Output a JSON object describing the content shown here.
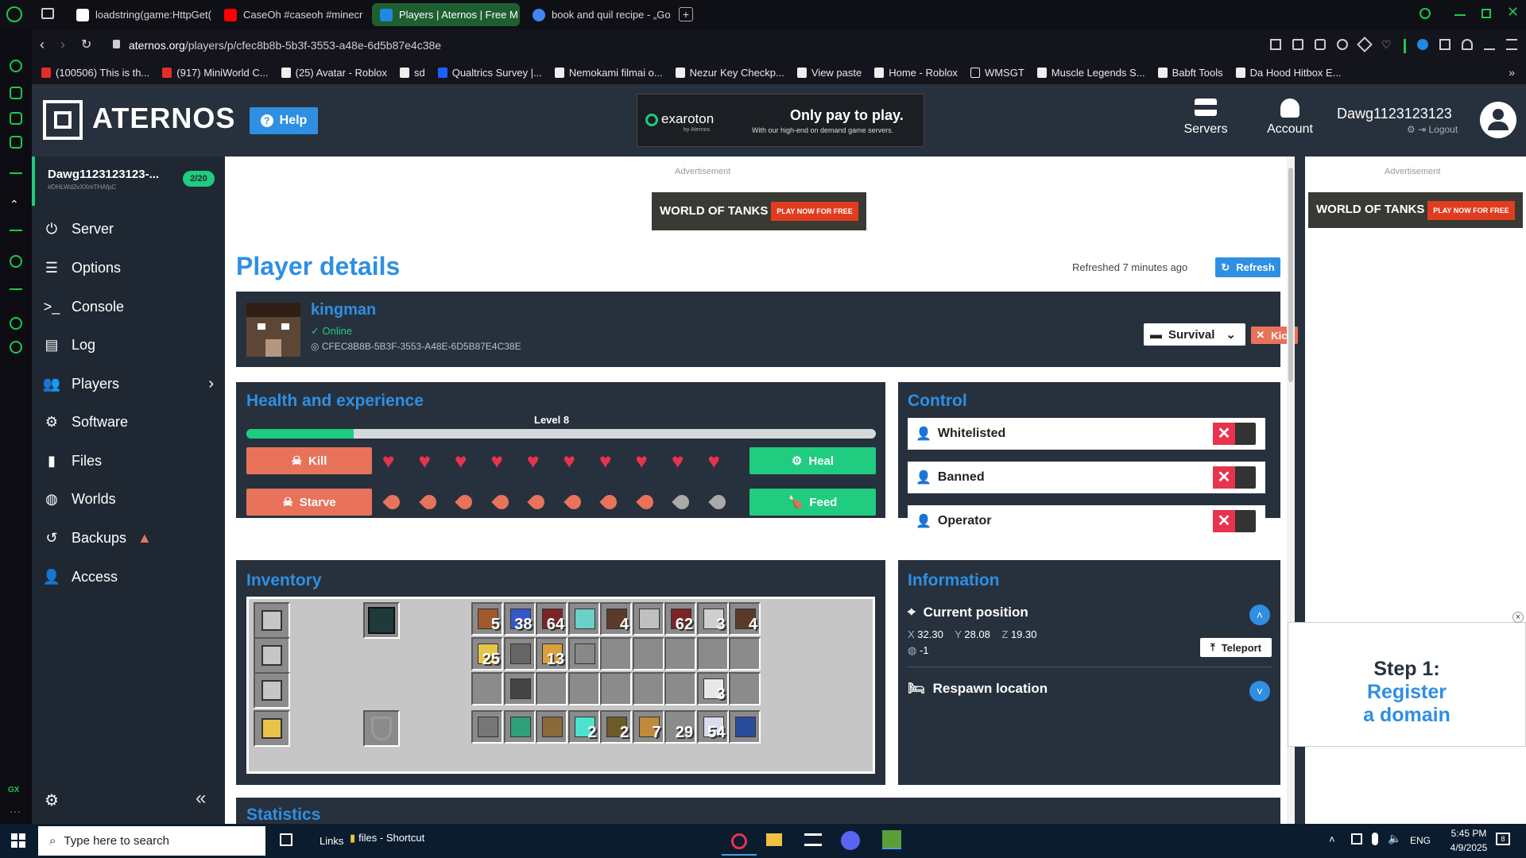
{
  "browser": {
    "tabs": [
      {
        "label": "loadstring(game:HttpGet(",
        "color": "#ffffff"
      },
      {
        "label": "CaseOh #caseoh #minecr",
        "color": "#ff0000"
      },
      {
        "label": "Players | Aternos | Free M",
        "color": "#1e88e5"
      },
      {
        "label": "book and quil recipe - „Go",
        "color": "#4285f4"
      }
    ],
    "new_tab": "+",
    "url_domain": "aternos.org",
    "url_path": "/players/p/cfec8b8b-5b3f-3553-a48e-6d5b87e4c38e",
    "bookmarks": [
      "(100506) This is th...",
      "(917) MiniWorld C...",
      "(25) Avatar - Roblox",
      "sd",
      "Qualtrics Survey |...",
      "Nemokami filmai o...",
      "Nezur Key Checkp...",
      "View paste",
      "Home - Roblox",
      "WMSGT",
      "Muscle Legends S...",
      "Babft Tools",
      "Da Hood Hitbox E..."
    ],
    "gx_label": "GX"
  },
  "header": {
    "logo": "ATERNOS",
    "help": "Help",
    "ad_brand": "exaroton",
    "ad_brand_sub": "by Aternos",
    "ad_headline": "Only pay to play.",
    "ad_sub": "With our high-end on demand game servers.",
    "servers": "Servers",
    "account": "Account",
    "username": "Dawg1123123123",
    "logout": "Logout"
  },
  "sidebar": {
    "server_name": "Dawg1123123123-...",
    "server_id": "#DHLWd2vXXmTHAfpC",
    "players_badge": "2/20",
    "items": [
      "Server",
      "Options",
      "Console",
      "Log",
      "Players",
      "Software",
      "Files",
      "Worlds",
      "Backups",
      "Access"
    ]
  },
  "main": {
    "ad_label": "Advertisement",
    "ad_text": "WORLD OF TANKS",
    "ad_cta": "PLAY NOW FOR FREE",
    "title": "Player details",
    "refreshed": "Refreshed 7 minutes ago",
    "refresh": "Refresh",
    "player": {
      "name": "kingman",
      "status": "Online",
      "uuid": "CFEC8B8B-5B3F-3553-A48E-6D5B87E4C38E",
      "gamemode": "Survival",
      "kick": "Kick"
    },
    "health": {
      "title": "Health and experience",
      "level": "Level 8",
      "xp_progress": 0.17,
      "kill": "Kill",
      "starve": "Starve",
      "heal": "Heal",
      "feed": "Feed",
      "hearts_full": 10,
      "food_full": 8,
      "food_total": 10
    },
    "control": {
      "title": "Control",
      "rows": [
        "Whitelisted",
        "Banned",
        "Operator"
      ]
    },
    "inventory": {
      "title": "Inventory",
      "counts": [
        "5",
        "38",
        "64",
        "4",
        "62",
        "3",
        "4",
        "25",
        "13",
        "3",
        "2",
        "2",
        "7",
        "29",
        "54"
      ]
    },
    "information": {
      "title": "Information",
      "position_title": "Current position",
      "x_label": "X",
      "x": "32.30",
      "y_label": "Y",
      "y": "28.08",
      "z_label": "Z",
      "z": "19.30",
      "dimension": "-1",
      "teleport": "Teleport",
      "respawn_title": "Respawn location"
    },
    "statistics_title": "Statistics"
  },
  "right_ad": {
    "label": "Advertisement",
    "ad_text": "WORLD OF TANKS",
    "ad_cta": "PLAY NOW FOR FREE",
    "popup_line1": "Step 1:",
    "popup_line2": "Register",
    "popup_line3": "a domain",
    "close": "×"
  },
  "taskbar": {
    "search_placeholder": "Type here to search",
    "links": "Links",
    "shortcut": "files - Shortcut",
    "lang": "ENG",
    "time": "5:45 PM",
    "date": "4/9/2025",
    "notif_count": "8"
  },
  "colors": {
    "accent": "#2f8fe2",
    "kill": "#e8735a",
    "heal": "#1fcc80",
    "danger": "#e8334e",
    "xp": "#1fcc80"
  }
}
